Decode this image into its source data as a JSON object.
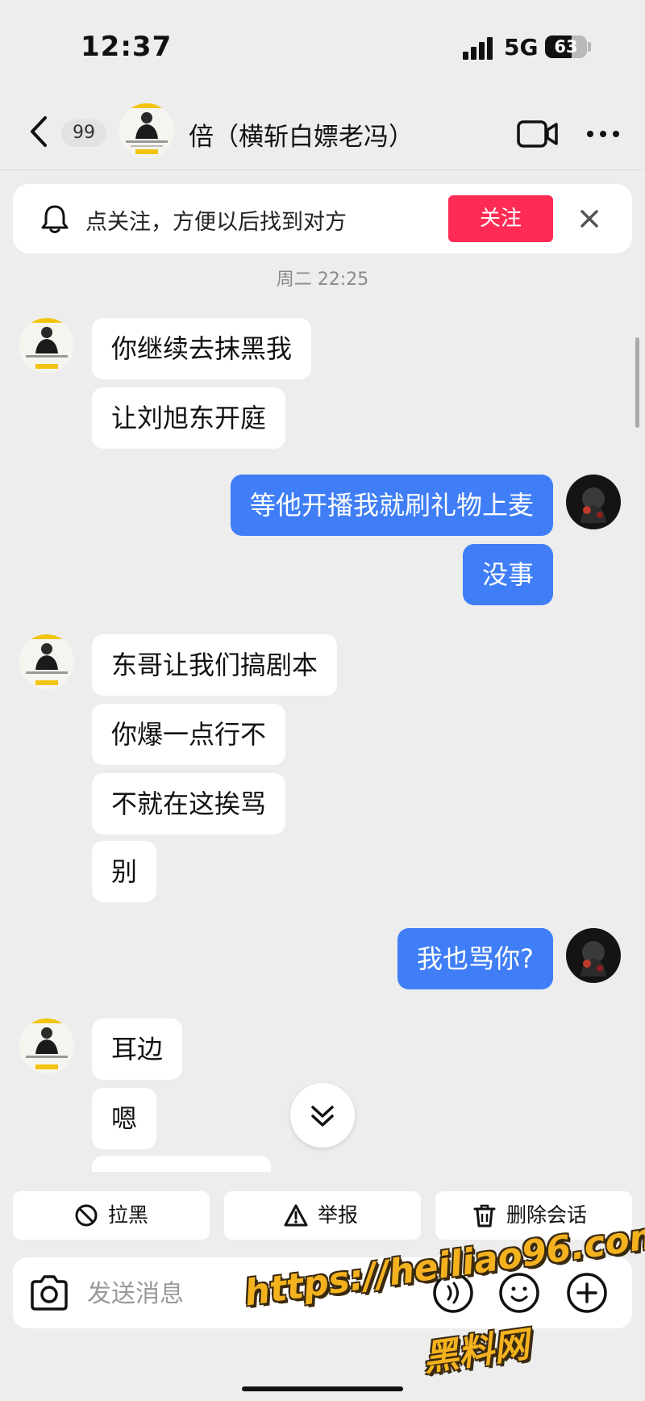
{
  "status_bar": {
    "time": "12:37",
    "network": "5G",
    "battery": "63",
    "battery_level": 0.63
  },
  "header": {
    "unread_count": "99",
    "title": "倍（横斩白嫖老冯）"
  },
  "follow_banner": {
    "text": "点关注，方便以后找到对方",
    "button": "关注"
  },
  "timestamp": "周二 22:25",
  "messages": [
    {
      "side": "in",
      "text": "你继续去抹黑我"
    },
    {
      "side": "in",
      "text": "让刘旭东开庭"
    },
    {
      "side": "out",
      "text": "等他开播我就刷礼物上麦"
    },
    {
      "side": "out",
      "text": "没事"
    },
    {
      "side": "in",
      "text": "东哥让我们搞剧本"
    },
    {
      "side": "in",
      "text": "你爆一点行不"
    },
    {
      "side": "in",
      "text": "不就在这挨骂"
    },
    {
      "side": "in",
      "text": "别"
    },
    {
      "side": "out",
      "text": "我也骂你?"
    },
    {
      "side": "in",
      "text": "耳边"
    },
    {
      "side": "in",
      "text": "嗯"
    }
  ],
  "actions": {
    "block": "拉黑",
    "report": "举报",
    "delete": "删除会话"
  },
  "input": {
    "placeholder": "发送消息",
    "value": ""
  },
  "watermark": {
    "url": "https://heiliao96.com",
    "name": "黑料网"
  },
  "colors": {
    "outgoing_bubble": "#3f7ef6",
    "follow_button": "#fe2c55",
    "background": "#ededed"
  },
  "icons": [
    "back-icon",
    "video-call-icon",
    "more-icon",
    "bell-icon",
    "close-icon",
    "chevron-double-down-icon",
    "block-icon",
    "warning-icon",
    "trash-icon",
    "camera-icon",
    "voice-icon",
    "emoji-icon",
    "plus-icon"
  ]
}
